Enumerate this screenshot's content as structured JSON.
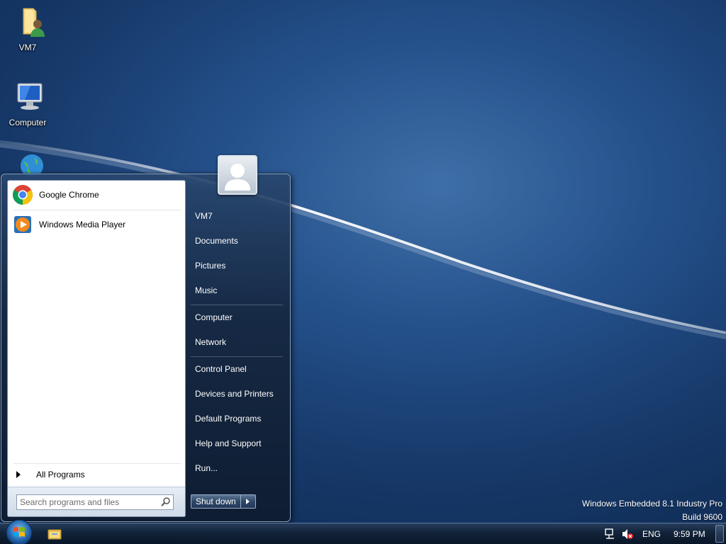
{
  "desktop": {
    "icons": [
      {
        "label": "VM7",
        "icon": "user-folder-icon"
      },
      {
        "label": "Computer",
        "icon": "computer-icon"
      },
      {
        "label": "",
        "icon": "network-globe-icon"
      }
    ],
    "watermark": {
      "line1": "Windows Embedded 8.1 Industry Pro",
      "line2": "Build 9600"
    }
  },
  "start_menu": {
    "pinned_programs": [
      {
        "label": "Google Chrome",
        "icon": "chrome-icon"
      },
      {
        "label": "Windows Media Player",
        "icon": "media-player-icon"
      }
    ],
    "all_programs_label": "All Programs",
    "search": {
      "placeholder": "Search programs and files",
      "value": ""
    },
    "right_items": [
      "VM7",
      "Documents",
      "Pictures",
      "Music",
      "Computer",
      "Network",
      "Control Panel",
      "Devices and Printers",
      "Default Programs",
      "Help and Support",
      "Run..."
    ],
    "shutdown_label": "Shut down"
  },
  "taskbar": {
    "pinned": [
      "windows-explorer-icon"
    ],
    "tray": {
      "language": "ENG",
      "time": "9:59 PM",
      "icons": [
        "network-icon",
        "volume-muted-icon"
      ]
    }
  },
  "colors": {
    "desktop_bg": "#1f4a80",
    "menu_bg": "#162a44",
    "accent": "#8aa6c8"
  }
}
